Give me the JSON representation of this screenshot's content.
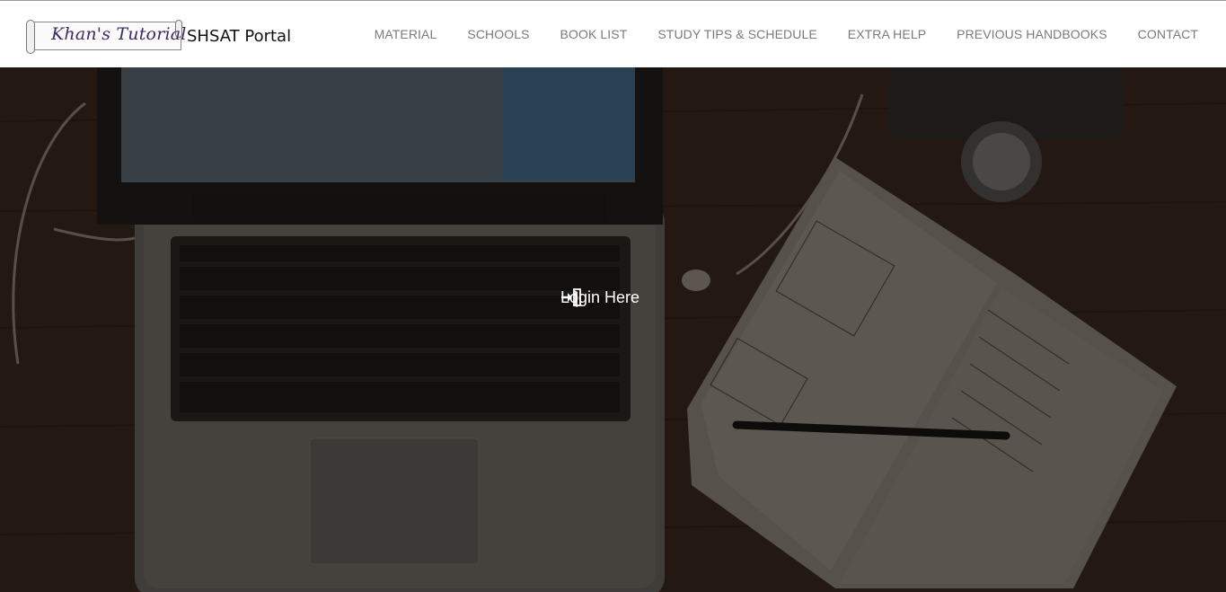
{
  "brand": {
    "logo_script": "Khan's Tutorial",
    "portal_name": "SHSAT Portal"
  },
  "nav": {
    "items": [
      {
        "label": "MATERIAL"
      },
      {
        "label": "SCHOOLS"
      },
      {
        "label": "BOOK LIST"
      },
      {
        "label": "STUDY TIPS & SCHEDULE"
      },
      {
        "label": "EXTRA HELP"
      },
      {
        "label": "PREVIOUS HANDBOOKS"
      },
      {
        "label": "CONTACT"
      }
    ]
  },
  "hero": {
    "login_label": "Login Here",
    "login_icon": "sign-in-icon",
    "background": "laptop-notebook-desk-photo"
  },
  "colors": {
    "nav_text": "#7a7a7a",
    "logo_script": "#3d2a63",
    "hero_overlay": "#2e2016"
  }
}
